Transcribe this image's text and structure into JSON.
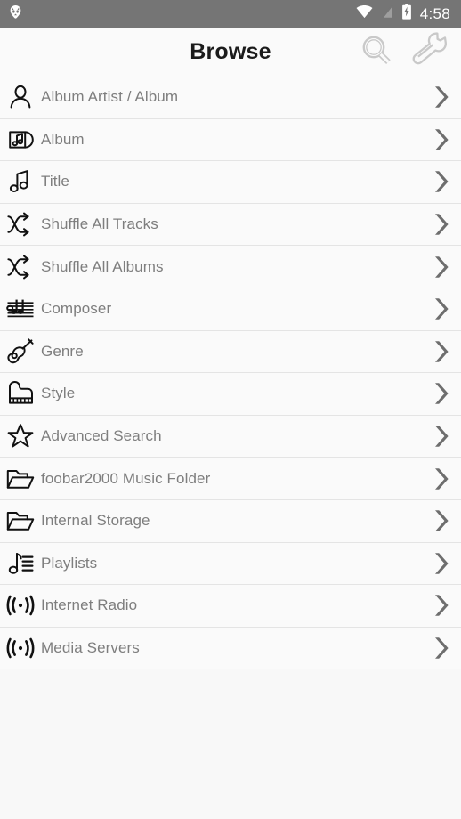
{
  "status_bar": {
    "app_logo_icon": "foobar2000-logo-icon",
    "wifi_icon": "wifi-icon",
    "signal_icon": "signal-off-icon",
    "battery_icon": "battery-charging-icon",
    "time": "4:58",
    "background_color": "#757575",
    "foreground_color": "#ffffff"
  },
  "app_bar": {
    "title": "Browse",
    "search_icon": "search-icon",
    "settings_icon": "wrench-icon",
    "icon_color": "#c8c8c8",
    "title_color": "#1c1c1c"
  },
  "theme": {
    "page_background": "#f8f8f8",
    "row_background": "#fafafa",
    "divider_color": "#e4e4e4",
    "label_color": "#7e7e7e",
    "icon_color": "#111111",
    "chevron_color": "#6e6e6e"
  },
  "browse_list": {
    "chevron_icon": "chevron-right-icon",
    "items": [
      {
        "label": "Album Artist / Album",
        "icon": "person-icon"
      },
      {
        "label": "Album",
        "icon": "album-sleeve-icon"
      },
      {
        "label": "Title",
        "icon": "music-note-icon"
      },
      {
        "label": "Shuffle All Tracks",
        "icon": "shuffle-icon"
      },
      {
        "label": "Shuffle All Albums",
        "icon": "shuffle-icon"
      },
      {
        "label": "Composer",
        "icon": "music-staff-icon"
      },
      {
        "label": "Genre",
        "icon": "guitar-icon"
      },
      {
        "label": "Style",
        "icon": "grand-piano-icon"
      },
      {
        "label": "Advanced Search",
        "icon": "star-outline-icon"
      },
      {
        "label": "foobar2000 Music Folder",
        "icon": "folder-icon"
      },
      {
        "label": "Internal Storage",
        "icon": "folder-icon"
      },
      {
        "label": "Playlists",
        "icon": "playlist-icon"
      },
      {
        "label": "Internet Radio",
        "icon": "broadcast-icon"
      },
      {
        "label": "Media Servers",
        "icon": "broadcast-icon"
      }
    ]
  }
}
